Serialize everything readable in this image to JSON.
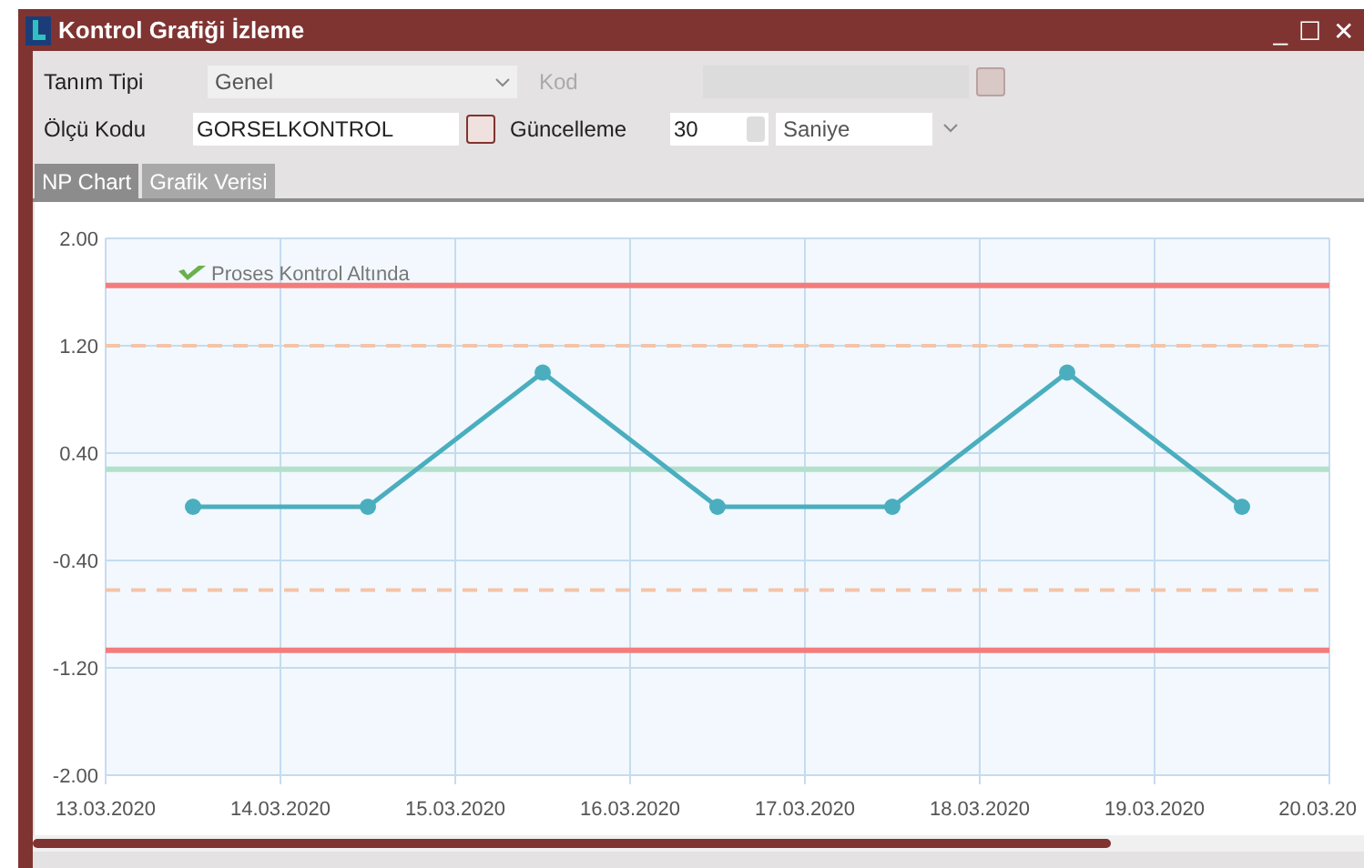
{
  "window": {
    "title": "Kontrol Grafiği İzleme",
    "controls": [
      "_",
      "☐",
      "✕"
    ]
  },
  "form": {
    "tanim_tipi": {
      "label": "Tanım Tipi",
      "value": "Genel"
    },
    "kod": {
      "label": "Kod",
      "disabled": true
    },
    "olcu_kodu": {
      "label": "Ölçü Kodu",
      "value": "GORSELKONTROL"
    },
    "guncelleme": {
      "label": "Güncelleme",
      "value": "30",
      "unit": "Saniye"
    }
  },
  "tabs": [
    {
      "label": "NP Chart",
      "selected": true
    },
    {
      "label": "Grafik Verisi",
      "selected": false
    }
  ],
  "chart_data": {
    "type": "line",
    "grid": true,
    "categories": [
      "13.03.2020",
      null,
      "14.03.2020",
      null,
      "15.03.2020",
      null,
      "16.03.2020",
      null,
      "17.03.2020",
      null,
      "18.03.2020",
      null,
      "19.03.2020",
      null,
      "20.03.20"
    ],
    "series": [
      {
        "color": "#4aaebf",
        "marker": "circle",
        "values": [
          null,
          0,
          null,
          0,
          null,
          1,
          null,
          0,
          null,
          0,
          null,
          1,
          null,
          0,
          null
        ]
      },
      {
        "color": "#f47c7c",
        "values": [
          1.65,
          1.65,
          1.65,
          1.65,
          1.65,
          1.65,
          1.65,
          1.65,
          1.65,
          1.65,
          1.65,
          1.65,
          1.65,
          1.65,
          1.65
        ]
      },
      {
        "color": "#f5c4a8",
        "line_style": "dashed",
        "values": [
          1.2,
          1.2,
          1.2,
          1.2,
          1.2,
          1.2,
          1.2,
          1.2,
          1.2,
          1.2,
          1.2,
          1.2,
          1.2,
          1.2,
          1.2
        ]
      },
      {
        "color": "#b3e0cc",
        "values": [
          0.28,
          0.28,
          0.28,
          0.28,
          0.28,
          0.28,
          0.28,
          0.28,
          0.28,
          0.28,
          0.28,
          0.28,
          0.28,
          0.28,
          0.28
        ]
      },
      {
        "color": "#f5c4a8",
        "line_style": "dashed",
        "values": [
          -0.62,
          -0.62,
          -0.62,
          -0.62,
          -0.62,
          -0.62,
          -0.62,
          -0.62,
          -0.62,
          -0.62,
          -0.62,
          -0.62,
          -0.62,
          -0.62,
          -0.62
        ]
      },
      {
        "color": "#f47c7c",
        "values": [
          -1.07,
          -1.07,
          -1.07,
          -1.07,
          -1.07,
          -1.07,
          -1.07,
          -1.07,
          -1.07,
          -1.07,
          -1.07,
          -1.07,
          -1.07,
          -1.07,
          -1.07
        ]
      }
    ],
    "ylim": [
      -2,
      2
    ],
    "yticks": [
      {
        "value": 2,
        "label": "2.00"
      },
      {
        "value": 1.2,
        "label": "1.20"
      },
      {
        "value": 0.4,
        "label": "0.40"
      },
      {
        "value": -0.4,
        "label": "-0.40"
      },
      {
        "value": -1.2,
        "label": "-1.20"
      },
      {
        "value": -2,
        "label": "-2.00"
      }
    ],
    "annotations": [
      {
        "text": "Proses Kontrol Altında"
      }
    ]
  }
}
